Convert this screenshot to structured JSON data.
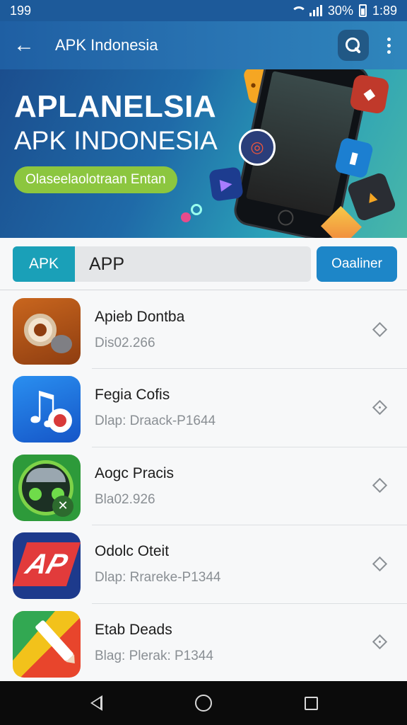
{
  "status_bar": {
    "left_text": "199",
    "battery_text": "30%",
    "time": "1:89"
  },
  "app_bar": {
    "title": "APK Indonesia",
    "back_icon": "arrow-left-icon",
    "search_icon": "search-icon",
    "menu_icon": "more-vert-icon"
  },
  "banner": {
    "title": "APLANELSIA",
    "subtitle": "APK INDONESIA",
    "pill_label": "Olaseelaolotraan Entan"
  },
  "search": {
    "tag_label": "APK",
    "value": "APP",
    "action_label": "Oaaliner"
  },
  "apps": [
    {
      "name": "Apieb Dontba",
      "meta": "Dis02.266"
    },
    {
      "name": "Fegia Cofis",
      "meta": "Dlap: Draack-P1644"
    },
    {
      "name": "Aogc Pracis",
      "meta": "Bla02.926"
    },
    {
      "name": "Odolc Oteit",
      "meta": "Dlap: Rrareke-P1344"
    },
    {
      "name": "Etab Deads",
      "meta": "Blag: Plerak: P1344"
    }
  ],
  "colors": {
    "app_bar": "#1f5fa3",
    "accent_teal": "#1aa0b8",
    "action_blue": "#1d86c8",
    "pill_green": "#8cc63f"
  }
}
